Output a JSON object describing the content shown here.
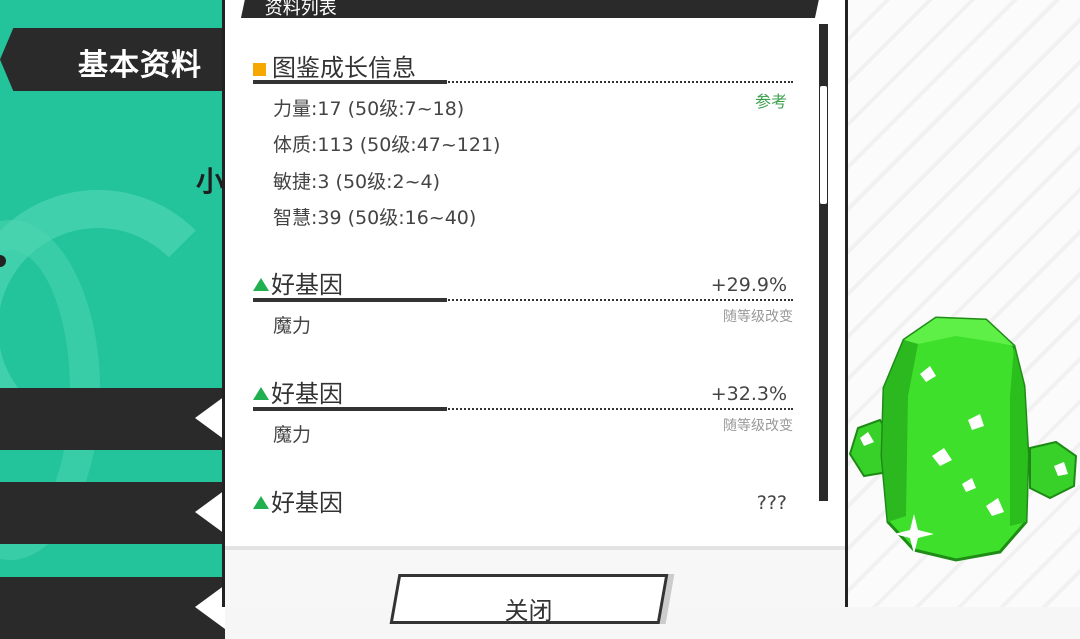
{
  "sidebar": {
    "basic_info_tab": "基本资料",
    "cut_text": "小"
  },
  "panel": {
    "header_title": "资料列表",
    "growth": {
      "title": "图鉴成长信息",
      "ref_label": "参考",
      "stats": [
        "力量:17  (50级:7~18)",
        "体质:113  (50级:47~121)",
        "敏捷:3  (50级:2~4)",
        "智慧:39  (50级:16~40)"
      ]
    },
    "genes": [
      {
        "title": "好基因",
        "value": "+29.9%",
        "note": "随等级改变",
        "attr": "魔力"
      },
      {
        "title": "好基因",
        "value": "+32.3%",
        "note": "随等级改变",
        "attr": "魔力"
      },
      {
        "title": "好基因",
        "value": "???"
      }
    ],
    "close_button": "关闭"
  },
  "colors": {
    "teal": "#23c49c",
    "dark": "#2a2a2a",
    "accent_orange": "#f6a800",
    "accent_green": "#21b04f"
  }
}
